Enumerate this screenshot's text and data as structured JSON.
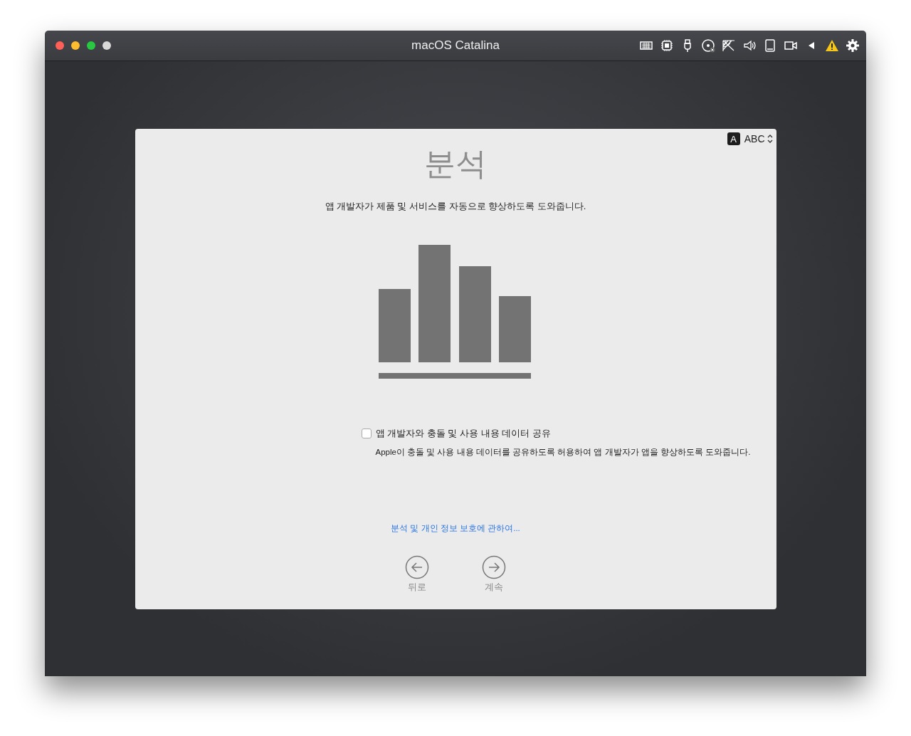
{
  "window": {
    "title": "macOS Catalina"
  },
  "input_source": {
    "label": "ABC",
    "badge": "A"
  },
  "page": {
    "title": "분석",
    "subtitle": "앱 개발자가 제품 및 서비스를 자동으로 향상하도록 도와줍니다."
  },
  "option": {
    "label": "앱 개발자와 충돌 및 사용 내용 데이터 공유",
    "checked": false,
    "description": "Apple이 충돌 및 사용 내용 데이터를 공유하도록 허용하여 앱 개발자가 앱을 향상하도록 도와줍니다."
  },
  "link": "분석 및 개인 정보 보호에 관하여...",
  "nav": [
    {
      "kind": "back",
      "label": "뒤로"
    },
    {
      "kind": "continue",
      "label": "계속"
    }
  ]
}
